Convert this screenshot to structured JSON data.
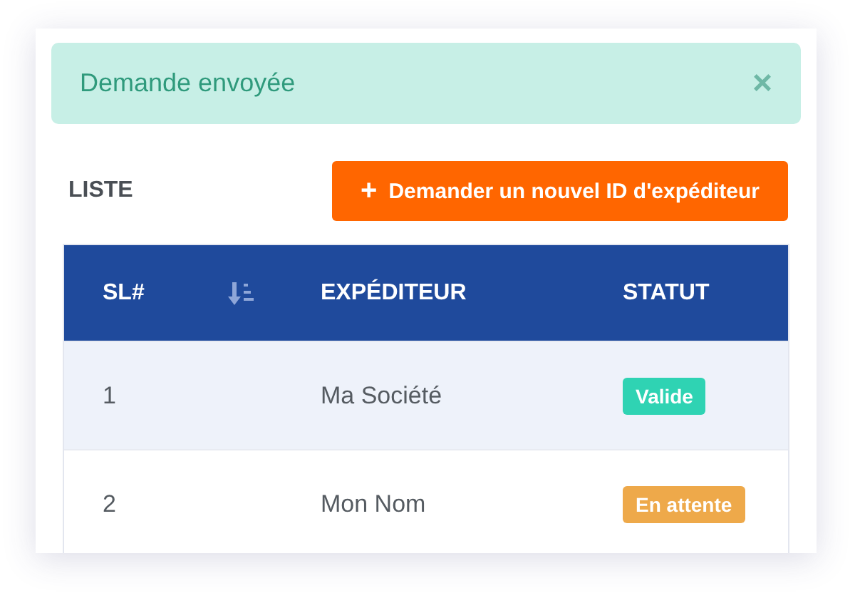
{
  "alert": {
    "message": "Demande envoyée",
    "close": "×"
  },
  "list_title": "LISTE",
  "request_button": {
    "icon": "+",
    "label": "Demander un nouvel ID d'expéditeur"
  },
  "table": {
    "columns": [
      "SL#",
      "EXPÉDITEUR",
      "STATUT"
    ],
    "rows": [
      {
        "sl": "1",
        "sender": "Ma Société",
        "status": "Valide",
        "color": "#2fd3b3"
      },
      {
        "sl": "2",
        "sender": "Mon Nom",
        "status": "En attente",
        "color": "#eea94a"
      }
    ]
  }
}
